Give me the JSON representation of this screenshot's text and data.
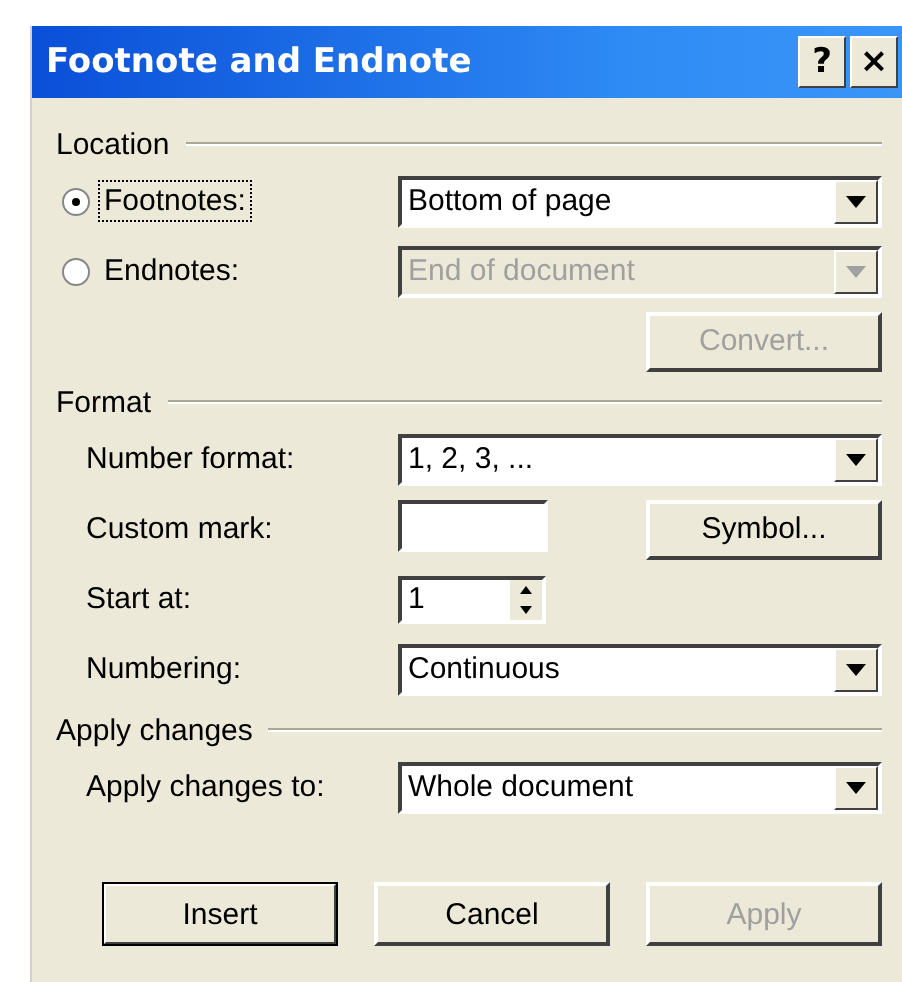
{
  "window": {
    "title": "Footnote and Endnote",
    "help_button": "?",
    "close_button": "×"
  },
  "location": {
    "heading": "Location",
    "options": [
      {
        "label": "Footnotes:",
        "selected": true,
        "dropdown": {
          "value": "Bottom of page",
          "disabled": false
        }
      },
      {
        "label": "Endnotes:",
        "selected": false,
        "dropdown": {
          "value": "End of document",
          "disabled": true
        }
      }
    ],
    "convert": {
      "label": "Convert...",
      "disabled": true
    }
  },
  "format": {
    "heading": "Format",
    "fields": [
      {
        "kind": "dropdown",
        "label": "Number format:",
        "value": "1, 2, 3, ..."
      },
      {
        "kind": "text",
        "label": "Custom mark:",
        "button": "Symbol..."
      },
      {
        "kind": "spinner",
        "label": "Start at:",
        "value": "1"
      },
      {
        "kind": "dropdown",
        "label": "Numbering:",
        "value": "Continuous"
      }
    ]
  },
  "apply_changes": {
    "heading": "Apply changes",
    "label": "Apply changes to:",
    "value": "Whole document"
  },
  "buttons": [
    {
      "label": "Insert",
      "default": true,
      "disabled": false
    },
    {
      "label": "Cancel",
      "default": false,
      "disabled": false
    },
    {
      "label": "Apply",
      "default": false,
      "disabled": true
    }
  ]
}
